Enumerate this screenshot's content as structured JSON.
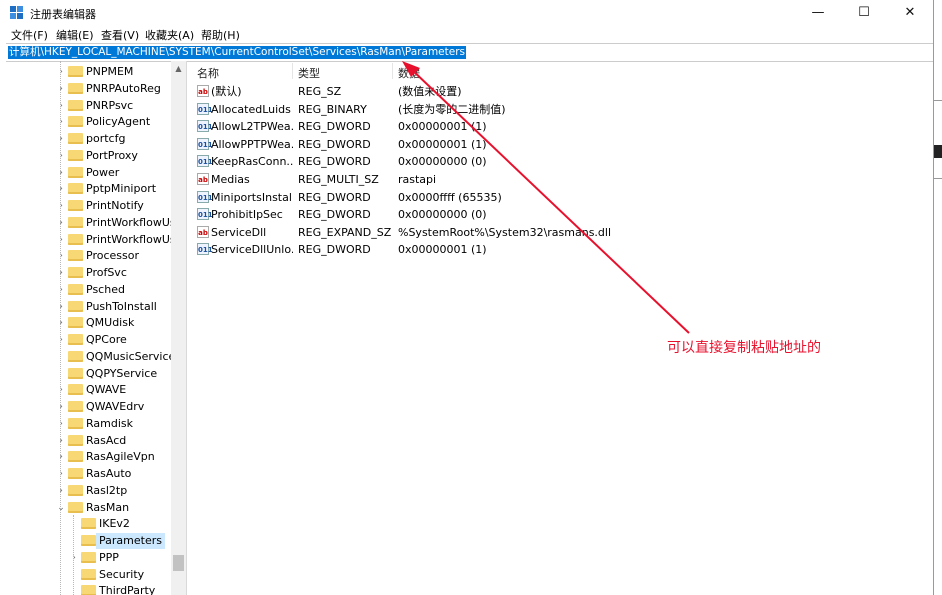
{
  "window": {
    "title": "注册表编辑器",
    "controls": {
      "minimize": "—",
      "maximize": "☐",
      "close": "✕"
    }
  },
  "menu": [
    "文件(F)",
    "编辑(E)",
    "查看(V)",
    "收藏夹(A)",
    "帮助(H)"
  ],
  "address": "计算机\\HKEY_LOCAL_MACHINE\\SYSTEM\\CurrentControlSet\\Services\\RasMan\\Parameters",
  "tree": [
    {
      "label": "PNPMEM",
      "expander": true
    },
    {
      "label": "PNRPAutoReg",
      "expander": true
    },
    {
      "label": "PNRPsvc",
      "expander": true
    },
    {
      "label": "PolicyAgent",
      "expander": true
    },
    {
      "label": "portcfg",
      "expander": true
    },
    {
      "label": "PortProxy",
      "expander": true
    },
    {
      "label": "Power",
      "expander": true
    },
    {
      "label": "PptpMiniport",
      "expander": true
    },
    {
      "label": "PrintNotify",
      "expander": true
    },
    {
      "label": "PrintWorkflowUse",
      "expander": true
    },
    {
      "label": "PrintWorkflowUse",
      "expander": true
    },
    {
      "label": "Processor",
      "expander": true
    },
    {
      "label": "ProfSvc",
      "expander": true
    },
    {
      "label": "Psched",
      "expander": true
    },
    {
      "label": "PushToInstall",
      "expander": true
    },
    {
      "label": "QMUdisk",
      "expander": true
    },
    {
      "label": "QPCore",
      "expander": true
    },
    {
      "label": "QQMusicService",
      "expander": false
    },
    {
      "label": "QQPYService",
      "expander": false
    },
    {
      "label": "QWAVE",
      "expander": true
    },
    {
      "label": "QWAVEdrv",
      "expander": true
    },
    {
      "label": "Ramdisk",
      "expander": true
    },
    {
      "label": "RasAcd",
      "expander": true
    },
    {
      "label": "RasAgileVpn",
      "expander": true
    },
    {
      "label": "RasAuto",
      "expander": true
    },
    {
      "label": "Rasl2tp",
      "expander": true
    },
    {
      "label": "RasMan",
      "expander": "open"
    },
    {
      "label": "IKEv2",
      "child": true,
      "expander": false
    },
    {
      "label": "Parameters",
      "child": true,
      "expander": false,
      "selected": true
    },
    {
      "label": "PPP",
      "child": true,
      "expander": true
    },
    {
      "label": "Security",
      "child": true,
      "expander": false
    },
    {
      "label": "ThirdParty",
      "child": true,
      "expander": false
    }
  ],
  "columns": {
    "name": "名称",
    "type": "类型",
    "data": "数据"
  },
  "values": [
    {
      "icon": "ab",
      "name": "(默认)",
      "type": "REG_SZ",
      "data": "(数值未设置)"
    },
    {
      "icon": "bin",
      "name": "AllocatedLuids",
      "type": "REG_BINARY",
      "data": "(长度为零的二进制值)"
    },
    {
      "icon": "bin",
      "name": "AllowL2TPWea...",
      "type": "REG_DWORD",
      "data": "0x00000001 (1)"
    },
    {
      "icon": "bin",
      "name": "AllowPPTPWea...",
      "type": "REG_DWORD",
      "data": "0x00000001 (1)"
    },
    {
      "icon": "bin",
      "name": "KeepRasConn...",
      "type": "REG_DWORD",
      "data": "0x00000000 (0)"
    },
    {
      "icon": "ab",
      "name": "Medias",
      "type": "REG_MULTI_SZ",
      "data": "rastapi"
    },
    {
      "icon": "bin",
      "name": "MiniportsInstal...",
      "type": "REG_DWORD",
      "data": "0x0000ffff (65535)"
    },
    {
      "icon": "bin",
      "name": "ProhibitIpSec",
      "type": "REG_DWORD",
      "data": "0x00000000 (0)"
    },
    {
      "icon": "ab",
      "name": "ServiceDll",
      "type": "REG_EXPAND_SZ",
      "data": "%SystemRoot%\\System32\\rasmans.dll"
    },
    {
      "icon": "bin",
      "name": "ServiceDllUnlo...",
      "type": "REG_DWORD",
      "data": "0x00000001 (1)"
    }
  ],
  "annotation": "可以直接复制粘贴地址的",
  "annotation_color": "#e8112d",
  "accent_color": "#0078d7",
  "folder_color": "#f8d775"
}
